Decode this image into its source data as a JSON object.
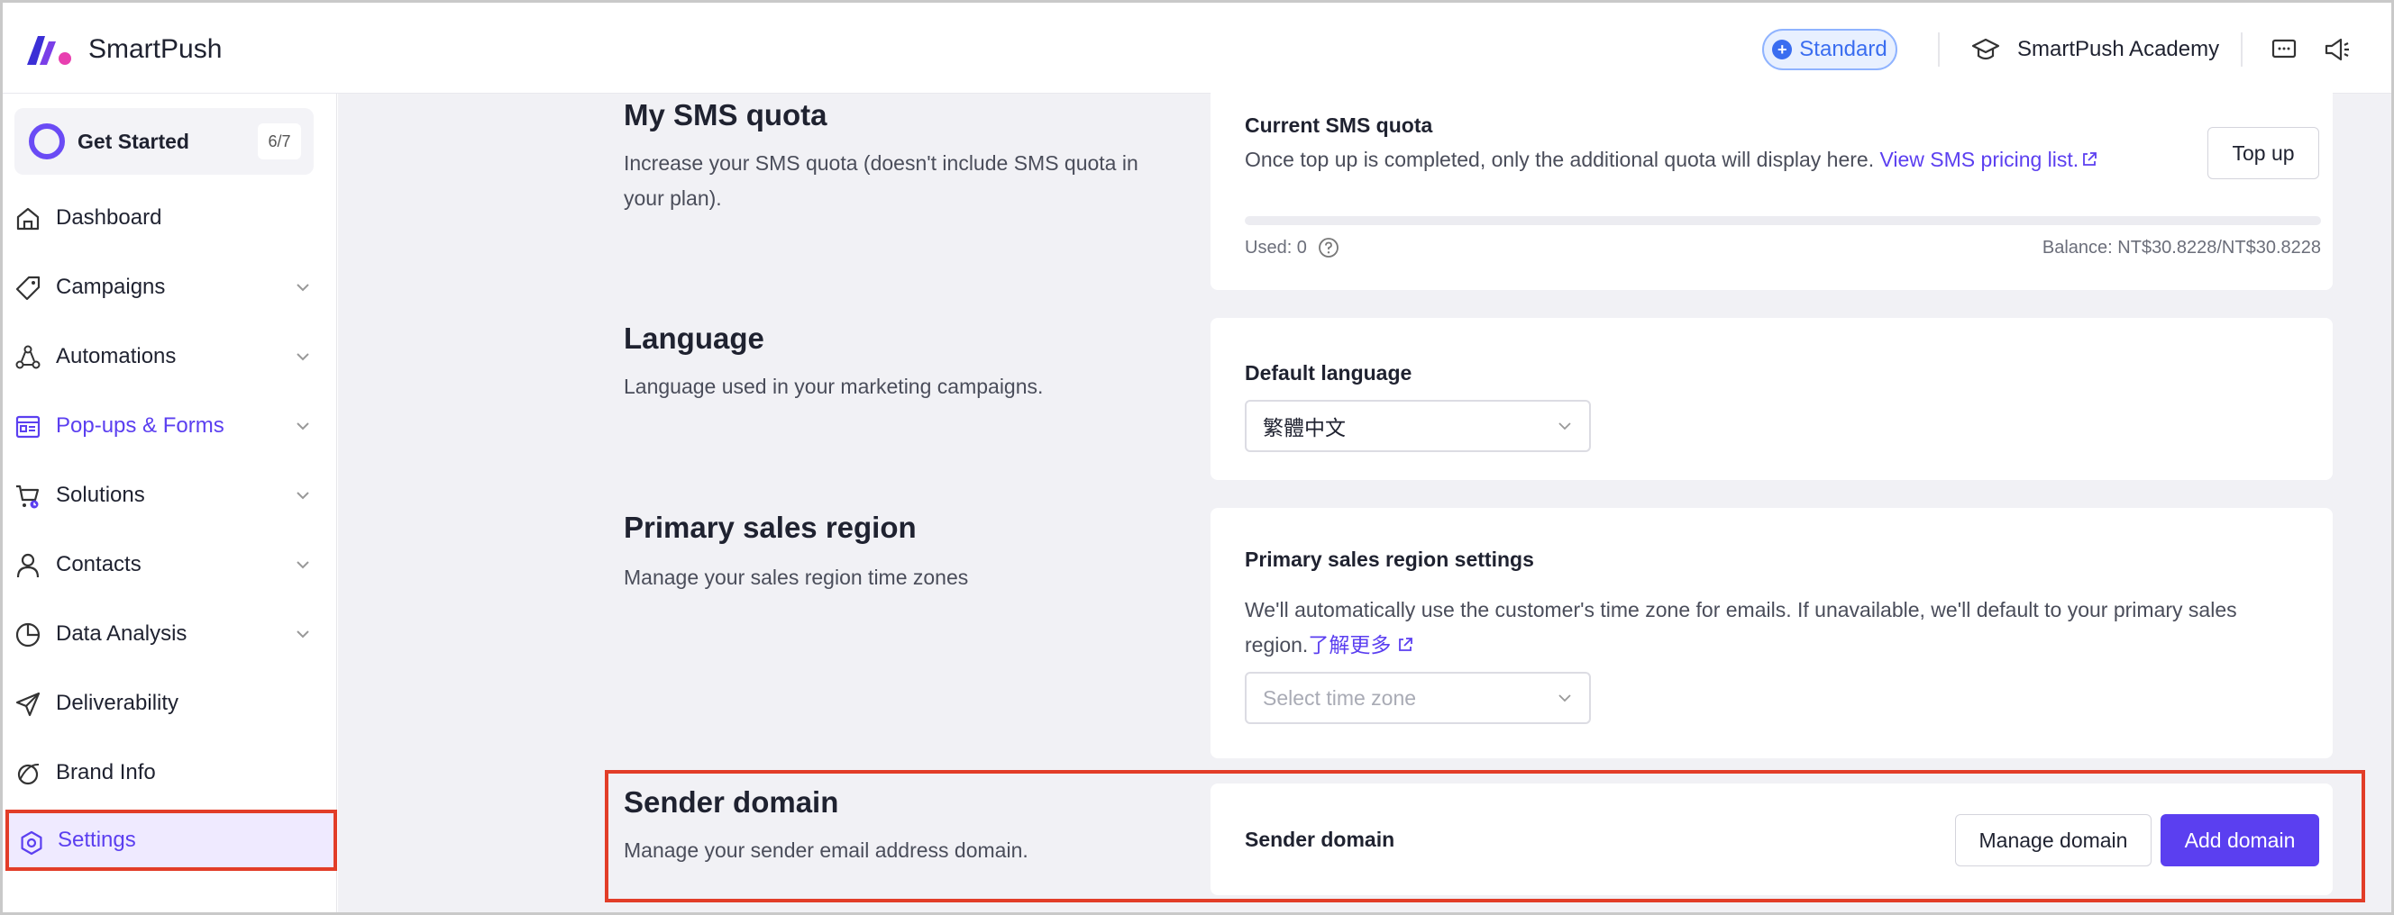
{
  "app": {
    "brand_name": "SmartPush",
    "plan_badge": "Standard",
    "academy_label": "SmartPush Academy",
    "accent_color": "#5b3ff0",
    "highlight_color": "#e23d28"
  },
  "topbar": {
    "icons": [
      "graduation-cap-icon",
      "chat-icon",
      "megaphone-icon"
    ]
  },
  "sidebar": {
    "get_started": {
      "label": "Get Started",
      "progress": "6/7"
    },
    "items": [
      {
        "label": "Dashboard",
        "icon": "home-icon",
        "expandable": false
      },
      {
        "label": "Campaigns",
        "icon": "tag-icon",
        "expandable": true
      },
      {
        "label": "Automations",
        "icon": "automation-icon",
        "expandable": true
      },
      {
        "label": "Pop-ups & Forms",
        "icon": "form-icon",
        "expandable": true
      },
      {
        "label": "Solutions",
        "icon": "cart-icon",
        "expandable": true
      },
      {
        "label": "Contacts",
        "icon": "person-icon",
        "expandable": true
      },
      {
        "label": "Data Analysis",
        "icon": "pie-chart-icon",
        "expandable": true
      },
      {
        "label": "Deliverability",
        "icon": "send-icon",
        "expandable": false
      },
      {
        "label": "Brand Info",
        "icon": "brand-icon",
        "expandable": false
      },
      {
        "label": "Settings",
        "icon": "settings-icon",
        "expandable": false,
        "active": true
      }
    ]
  },
  "sections": {
    "sms": {
      "title": "My SMS quota",
      "description": "Increase your SMS quota (doesn't include SMS quota in your plan).",
      "card_title": "Current SMS quota",
      "card_text": "Once top up is completed, only the additional quota will display here.",
      "link_text": "View SMS pricing list.",
      "top_up_button": "Top up",
      "used_label": "Used: 0",
      "balance_label": "Balance: NT$30.8228/NT$30.8228",
      "used_fraction": 0
    },
    "language": {
      "title": "Language",
      "description": "Language used in your marketing campaigns.",
      "card_title": "Default language",
      "selected": "繁體中文"
    },
    "region": {
      "title": "Primary sales region",
      "description": "Manage your sales region time zones",
      "card_title": "Primary sales region settings",
      "card_text_1": "We'll automatically use the customer's time zone for emails. If unavailable, we'll default to your primary sales",
      "card_text_2": "region.",
      "link_text": "了解更多",
      "select_placeholder": "Select time zone"
    },
    "sender": {
      "title": "Sender domain",
      "description": "Manage your sender email address domain.",
      "card_title": "Sender domain",
      "manage_button": "Manage domain",
      "add_button": "Add domain"
    }
  }
}
